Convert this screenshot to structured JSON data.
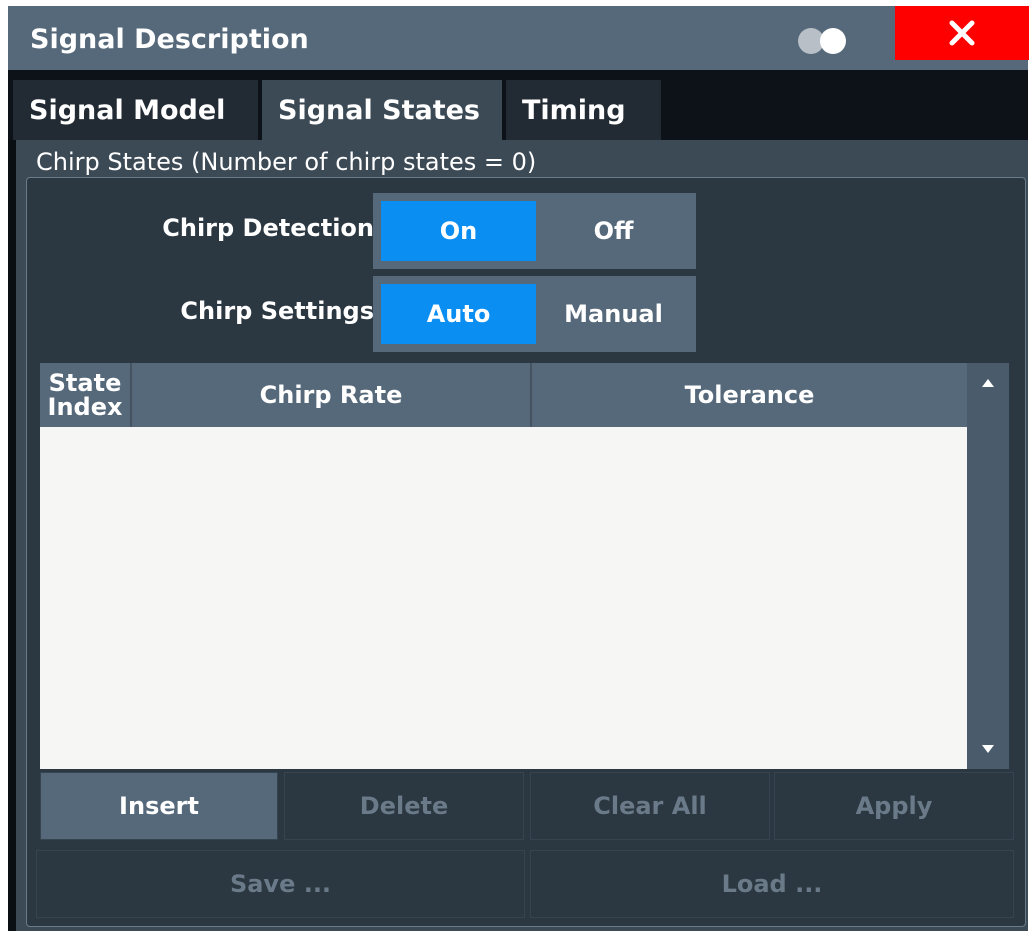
{
  "window": {
    "title": "Signal Description",
    "close_label": "✕"
  },
  "tabs": [
    {
      "label": "Signal Model",
      "active": false
    },
    {
      "label": "Signal States",
      "active": true
    },
    {
      "label": "Timing",
      "active": false
    }
  ],
  "group": {
    "caption": "Chirp States (Number of chirp states = 0)"
  },
  "chirp_detection": {
    "label": "Chirp Detection",
    "options": [
      "On",
      "Off"
    ],
    "selected": "On"
  },
  "chirp_settings": {
    "label": "Chirp Settings",
    "options": [
      "Auto",
      "Manual"
    ],
    "selected": "Auto"
  },
  "table": {
    "columns": [
      "State Index",
      "Chirp Rate",
      "Tolerance"
    ],
    "rows": []
  },
  "buttons": {
    "insert": "Insert",
    "delete": "Delete",
    "clear_all": "Clear All",
    "apply": "Apply",
    "save": "Save ...",
    "load": "Load ..."
  },
  "icons": {
    "toggle": "toggle-circles-icon",
    "close": "close-icon",
    "scroll_up": "scroll-up-icon",
    "scroll_down": "scroll-down-icon"
  },
  "colors": {
    "selected_accent": "#0a8ef2",
    "close_button": "#ff0000",
    "title_bar": "#56697a"
  }
}
